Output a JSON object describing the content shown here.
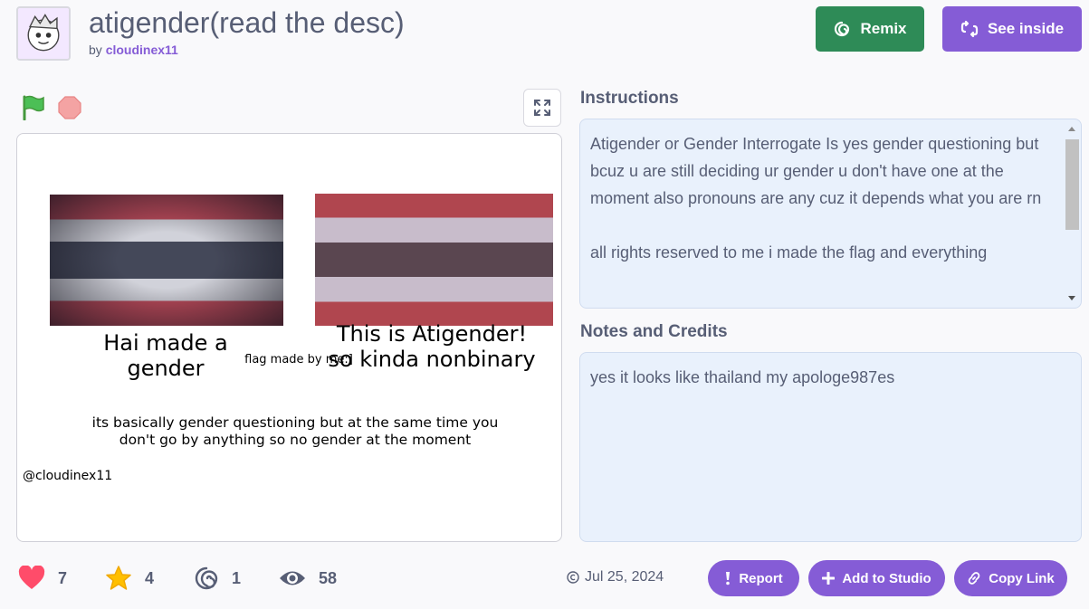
{
  "header": {
    "title": "atigender(read the desc)",
    "by_label": "by",
    "author": "cloudinex11",
    "remix_label": "Remix",
    "see_inside_label": "See inside"
  },
  "stage": {
    "text_hai": "Hai made a gender",
    "text_flag_by": "flag made by me:]",
    "text_atigender": "This is Atigender! so kinda nonbinary",
    "text_description": "its basically gender questioning but at the same time you don't go by anything so no gender at the moment",
    "text_handle": "@cloudinex11"
  },
  "instructions": {
    "title": "Instructions",
    "text": "Atigender or Gender Interrogate Is yes gender questioning but bcuz u are still deciding ur gender u don't have one at the moment also pronouns are any cuz it depends what you are rn\n\nall rights reserved to me i made the flag and everything"
  },
  "notes": {
    "title": "Notes and Credits",
    "text": "yes it looks like thailand my apologe987es"
  },
  "stats": {
    "loves": "7",
    "favorites": "4",
    "remixes": "1",
    "views": "58"
  },
  "date": "Jul 25, 2024",
  "actions": {
    "report_label": "Report",
    "add_to_studio_label": "Add to Studio",
    "copy_link_label": "Copy Link"
  },
  "icons": [
    "project-thumbnail",
    "remix-icon",
    "see-inside-icon",
    "green-flag-icon",
    "stop-icon",
    "fullscreen-icon",
    "heart-icon",
    "star-icon",
    "remix-swirl-icon",
    "eye-icon",
    "copyright-icon",
    "report-icon",
    "plus-icon",
    "link-icon"
  ],
  "colors": {
    "accent": "#855cd6",
    "remix_green": "#2e8b57",
    "love_red": "#ff4c6a",
    "favorite_yellow": "#ffbf00",
    "instructions_bg": "#e9f1fc"
  }
}
